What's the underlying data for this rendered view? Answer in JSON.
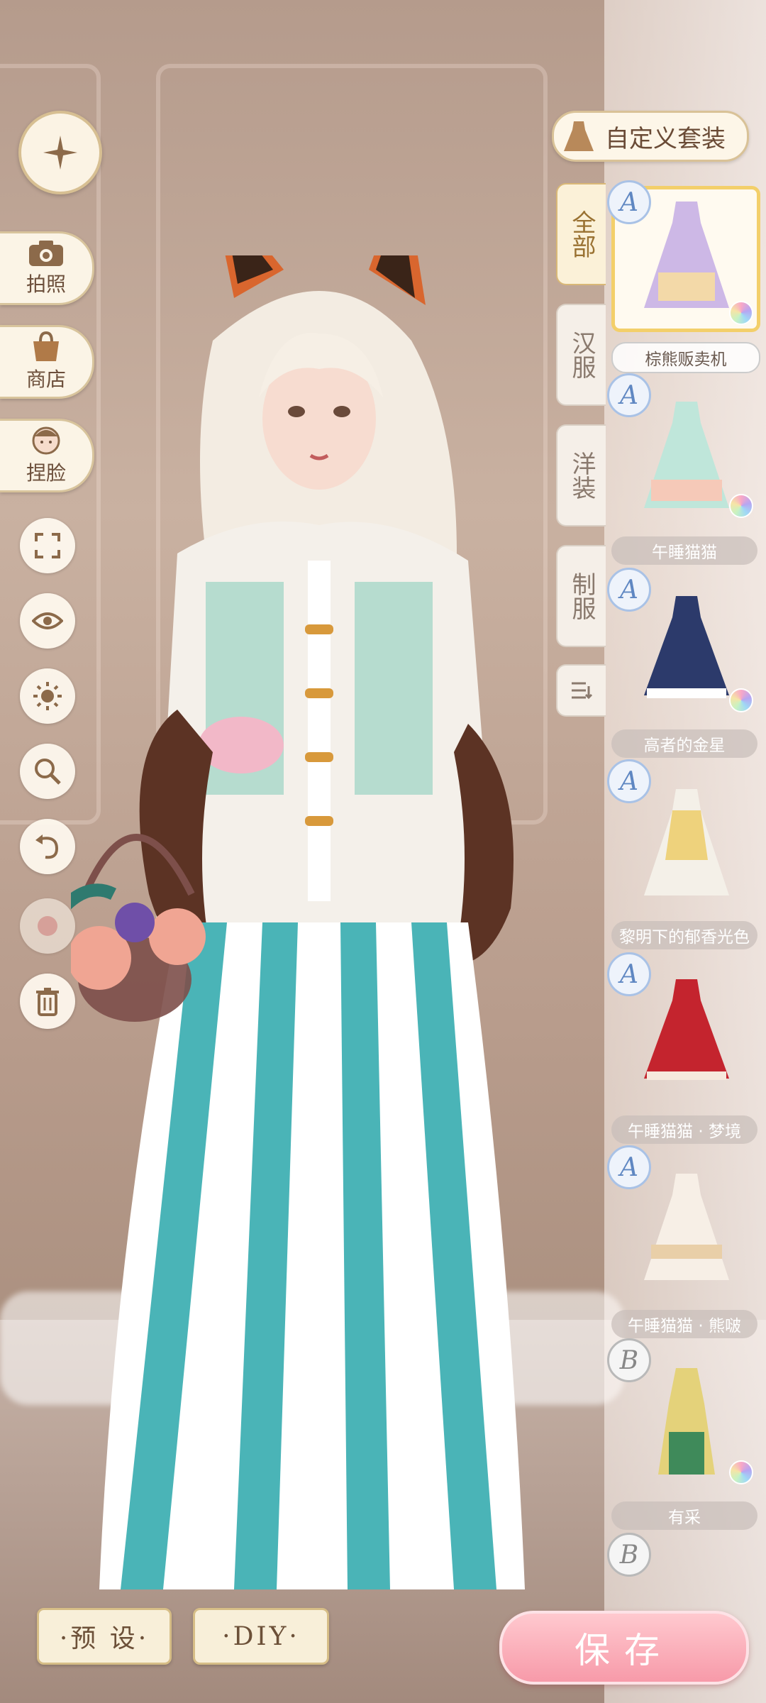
{
  "left_menu": {
    "photo_label": "拍照",
    "shop_label": "商店",
    "face_label": "捏脸"
  },
  "right_panel": {
    "custom_outfit_label": "自定义套装",
    "tabs": [
      "全部",
      "汉服",
      "洋装",
      "制服"
    ],
    "outfits": [
      {
        "grade": "A",
        "name": "棕熊贩卖机"
      },
      {
        "grade": "A",
        "name": "午睡猫猫"
      },
      {
        "grade": "A",
        "name": "高者的金星"
      },
      {
        "grade": "A",
        "name": "黎明下的郁香光色"
      },
      {
        "grade": "A",
        "name": "午睡猫猫 · 梦境"
      },
      {
        "grade": "A",
        "name": "午睡猫猫 · 熊啵"
      },
      {
        "grade": "B",
        "name": "有采"
      },
      {
        "grade": "B",
        "name": ""
      }
    ]
  },
  "bottom": {
    "preset_label": "·预 设·",
    "diy_label": "·DIY·",
    "save_label": "保存"
  },
  "colors": {
    "accent_gold": "#d9c297",
    "save_pink": "#f79aa9",
    "grade_blue": "#5f87c2"
  }
}
